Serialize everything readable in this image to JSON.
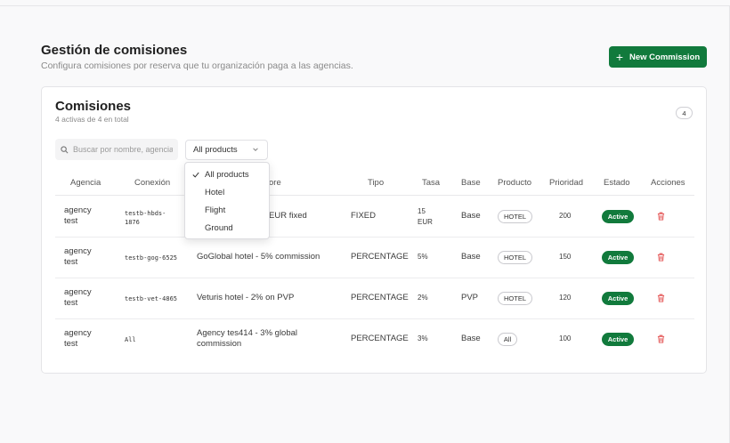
{
  "header": {
    "title": "Gestión de comisiones",
    "subtitle": "Configura comisiones por reserva que tu organización paga a las agencias.",
    "new_button": "New Commission"
  },
  "card": {
    "title": "Comisiones",
    "subtitle": "4 activas de 4 en total",
    "count": "4"
  },
  "filters": {
    "search_placeholder": "Buscar por nombre, agencia",
    "product_selected": "All products",
    "product_options": [
      "All products",
      "Hotel",
      "Flight",
      "Ground"
    ]
  },
  "table": {
    "columns": [
      "Agencia",
      "Conexión",
      "ore",
      "Tipo",
      "Tasa",
      "Base",
      "Producto",
      "Prioridad",
      "Estado",
      "Acciones"
    ],
    "rows": [
      {
        "agency": [
          "agency",
          "test"
        ],
        "connection": [
          "testb-hbds-",
          "1876"
        ],
        "name": [
          "EUR fixed"
        ],
        "type": "FIXED",
        "rate": [
          "15",
          "EUR"
        ],
        "base": "Base",
        "product": "HOTEL",
        "priority": "200",
        "status": "Active"
      },
      {
        "agency": [
          "agency",
          "test"
        ],
        "connection": [
          "testb-gog-6525"
        ],
        "name": [
          "GoGlobal hotel - 5% commission"
        ],
        "type": "PERCENTAGE",
        "rate": [
          "5%"
        ],
        "base": "Base",
        "product": "HOTEL",
        "priority": "150",
        "status": "Active"
      },
      {
        "agency": [
          "agency",
          "test"
        ],
        "connection": [
          "testb-vet-4865"
        ],
        "name": [
          "Veturis hotel - 2% on PVP"
        ],
        "type": "PERCENTAGE",
        "rate": [
          "2%"
        ],
        "base": "PVP",
        "product": "HOTEL",
        "priority": "120",
        "status": "Active"
      },
      {
        "agency": [
          "agency",
          "test"
        ],
        "connection": [
          "All"
        ],
        "name": [
          "Agency tes414 - 3% global",
          "commission"
        ],
        "type": "PERCENTAGE",
        "rate": [
          "3%"
        ],
        "base": "Base",
        "product": "All",
        "priority": "100",
        "status": "Active"
      }
    ]
  },
  "colors": {
    "accent": "#117a3c",
    "danger": "#e24b4b"
  },
  "icons": {
    "new_button": "plus-icon",
    "search": "search-icon",
    "select": "chevron-down-icon",
    "selected_option": "check-icon",
    "delete": "trash-icon"
  }
}
